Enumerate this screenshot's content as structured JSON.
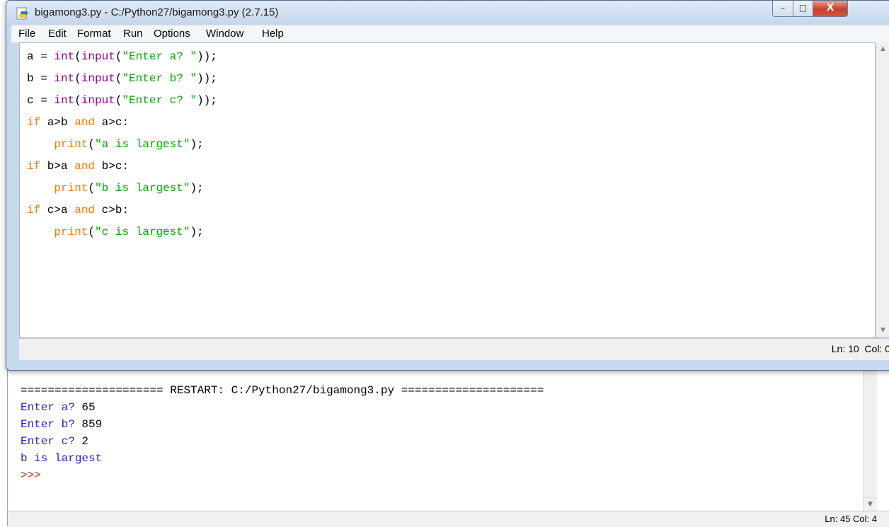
{
  "editor": {
    "title": "bigamong3.py - C:/Python27/bigamong3.py (2.7.15)",
    "window_controls": {
      "minimize": "–",
      "maximize": "□",
      "close": "X"
    },
    "menu": [
      "File",
      "Edit",
      "Format",
      "Run",
      "Options",
      "Window",
      "Help"
    ],
    "code": [
      [
        {
          "t": "a = ",
          "c": "df"
        },
        {
          "t": "int",
          "c": "bi"
        },
        {
          "t": "(",
          "c": "df"
        },
        {
          "t": "input",
          "c": "bi"
        },
        {
          "t": "(",
          "c": "df"
        },
        {
          "t": "\"Enter a? \"",
          "c": "st"
        },
        {
          "t": "));",
          "c": "df"
        }
      ],
      [
        {
          "t": "b = ",
          "c": "df"
        },
        {
          "t": "int",
          "c": "bi"
        },
        {
          "t": "(",
          "c": "df"
        },
        {
          "t": "input",
          "c": "bi"
        },
        {
          "t": "(",
          "c": "df"
        },
        {
          "t": "\"Enter b? \"",
          "c": "st"
        },
        {
          "t": "));",
          "c": "df"
        }
      ],
      [
        {
          "t": "c = ",
          "c": "df"
        },
        {
          "t": "int",
          "c": "bi"
        },
        {
          "t": "(",
          "c": "df"
        },
        {
          "t": "input",
          "c": "bi"
        },
        {
          "t": "(",
          "c": "df"
        },
        {
          "t": "\"Enter c? \"",
          "c": "st"
        },
        {
          "t": "));",
          "c": "df"
        }
      ],
      [
        {
          "t": "if",
          "c": "kw"
        },
        {
          "t": " a>b ",
          "c": "df"
        },
        {
          "t": "and",
          "c": "kw"
        },
        {
          "t": " a>c:",
          "c": "df"
        }
      ],
      [
        {
          "t": "    ",
          "c": "df"
        },
        {
          "t": "print",
          "c": "kw"
        },
        {
          "t": "(",
          "c": "df"
        },
        {
          "t": "\"a is largest\"",
          "c": "st"
        },
        {
          "t": ");",
          "c": "df"
        }
      ],
      [
        {
          "t": "if",
          "c": "kw"
        },
        {
          "t": " b>a ",
          "c": "df"
        },
        {
          "t": "and",
          "c": "kw"
        },
        {
          "t": " b>c:",
          "c": "df"
        }
      ],
      [
        {
          "t": "    ",
          "c": "df"
        },
        {
          "t": "print",
          "c": "kw"
        },
        {
          "t": "(",
          "c": "df"
        },
        {
          "t": "\"b is largest\"",
          "c": "st"
        },
        {
          "t": ");",
          "c": "df"
        }
      ],
      [
        {
          "t": "if",
          "c": "kw"
        },
        {
          "t": " c>a ",
          "c": "df"
        },
        {
          "t": "and",
          "c": "kw"
        },
        {
          "t": " c>b:",
          "c": "df"
        }
      ],
      [
        {
          "t": "    ",
          "c": "df"
        },
        {
          "t": "print",
          "c": "kw"
        },
        {
          "t": "(",
          "c": "df"
        },
        {
          "t": "\"c is largest\"",
          "c": "st"
        },
        {
          "t": ");",
          "c": "df"
        }
      ]
    ],
    "status": "Ln: 10  Col: 0"
  },
  "shell": {
    "lines": [
      [
        {
          "t": "===================== RESTART: C:/Python27/bigamong3.py =====================",
          "c": "restart"
        }
      ],
      [
        {
          "t": "Enter a? ",
          "c": "out"
        },
        {
          "t": "65",
          "c": "user-in"
        }
      ],
      [
        {
          "t": "Enter b? ",
          "c": "out"
        },
        {
          "t": "859",
          "c": "user-in"
        }
      ],
      [
        {
          "t": "Enter c? ",
          "c": "out"
        },
        {
          "t": "2",
          "c": "user-in"
        }
      ],
      [
        {
          "t": "b is largest",
          "c": "out"
        }
      ],
      [
        {
          "t": ">>> ",
          "c": "pr"
        }
      ]
    ],
    "status": "Ln: 45  Col: 4"
  },
  "colors": {
    "keyword": "#ff7700",
    "builtin": "#900090",
    "string": "#00aa00",
    "shell_output": "#1f1fdd",
    "prompt": "#b8320f"
  }
}
